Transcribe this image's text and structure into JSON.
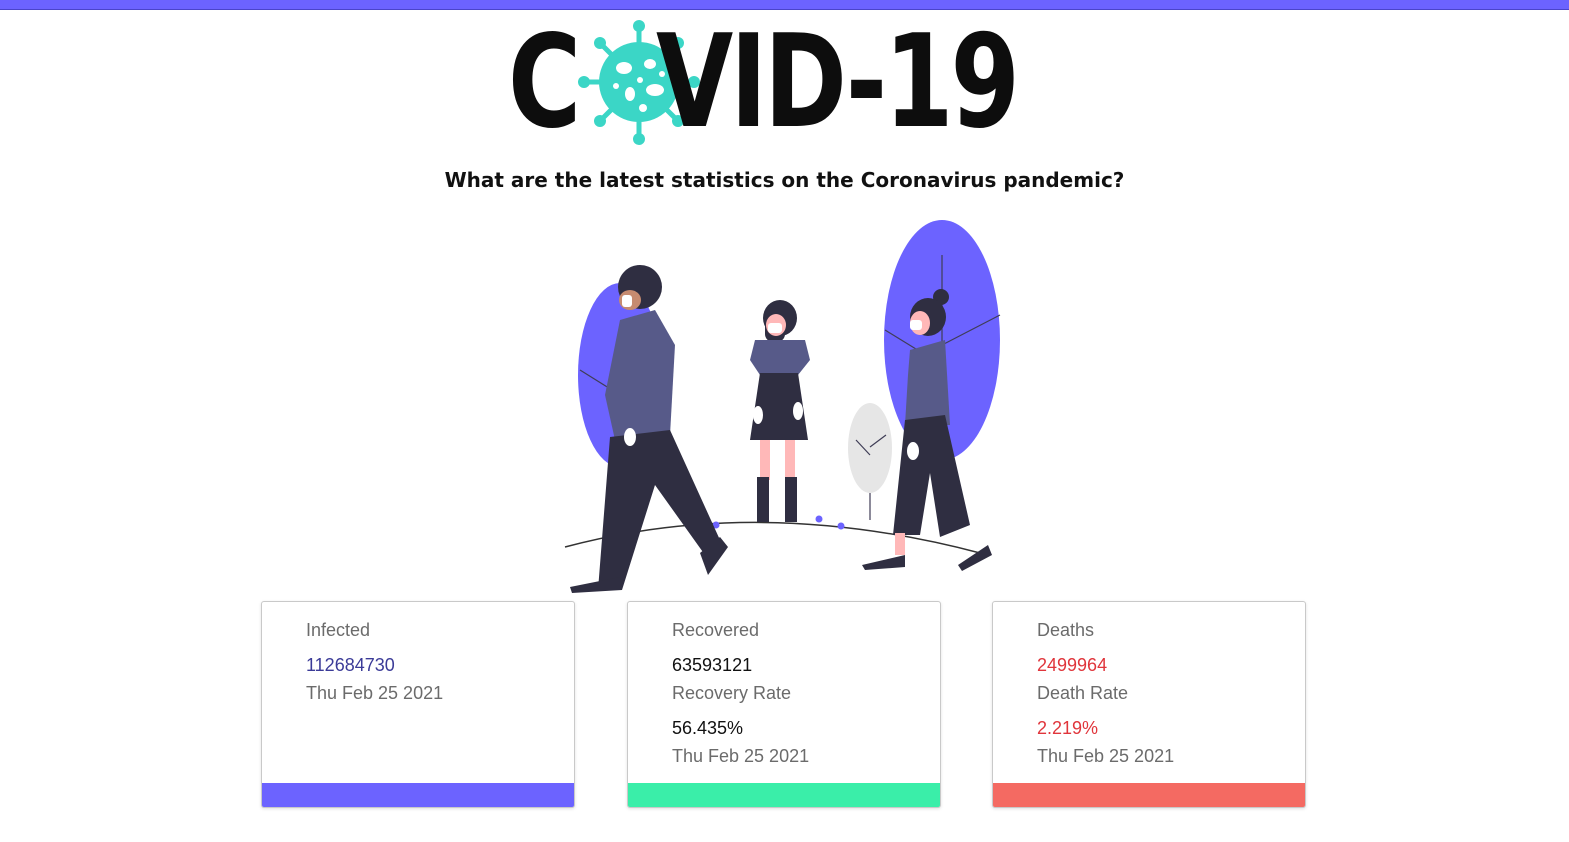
{
  "header": {
    "logo_prefix": "C",
    "logo_suffix": "VID-19",
    "subtitle": "What are the latest statistics on the Coronavirus pandemic?"
  },
  "colors": {
    "accent": "#6c63ff",
    "infected": "#6c63ff",
    "recovered": "#3aeea9",
    "deaths": "#f46a62",
    "virus": "#3bd6c6"
  },
  "cards": {
    "infected": {
      "title": "Infected",
      "count": "112684730",
      "date": "Thu Feb 25 2021"
    },
    "recovered": {
      "title": "Recovered",
      "count": "63593121",
      "rate_label": "Recovery Rate",
      "rate": "56.435%",
      "date": "Thu Feb 25 2021"
    },
    "deaths": {
      "title": "Deaths",
      "count": "2499964",
      "rate_label": "Death Rate",
      "rate": "2.219%",
      "date": "Thu Feb 25 2021"
    }
  }
}
